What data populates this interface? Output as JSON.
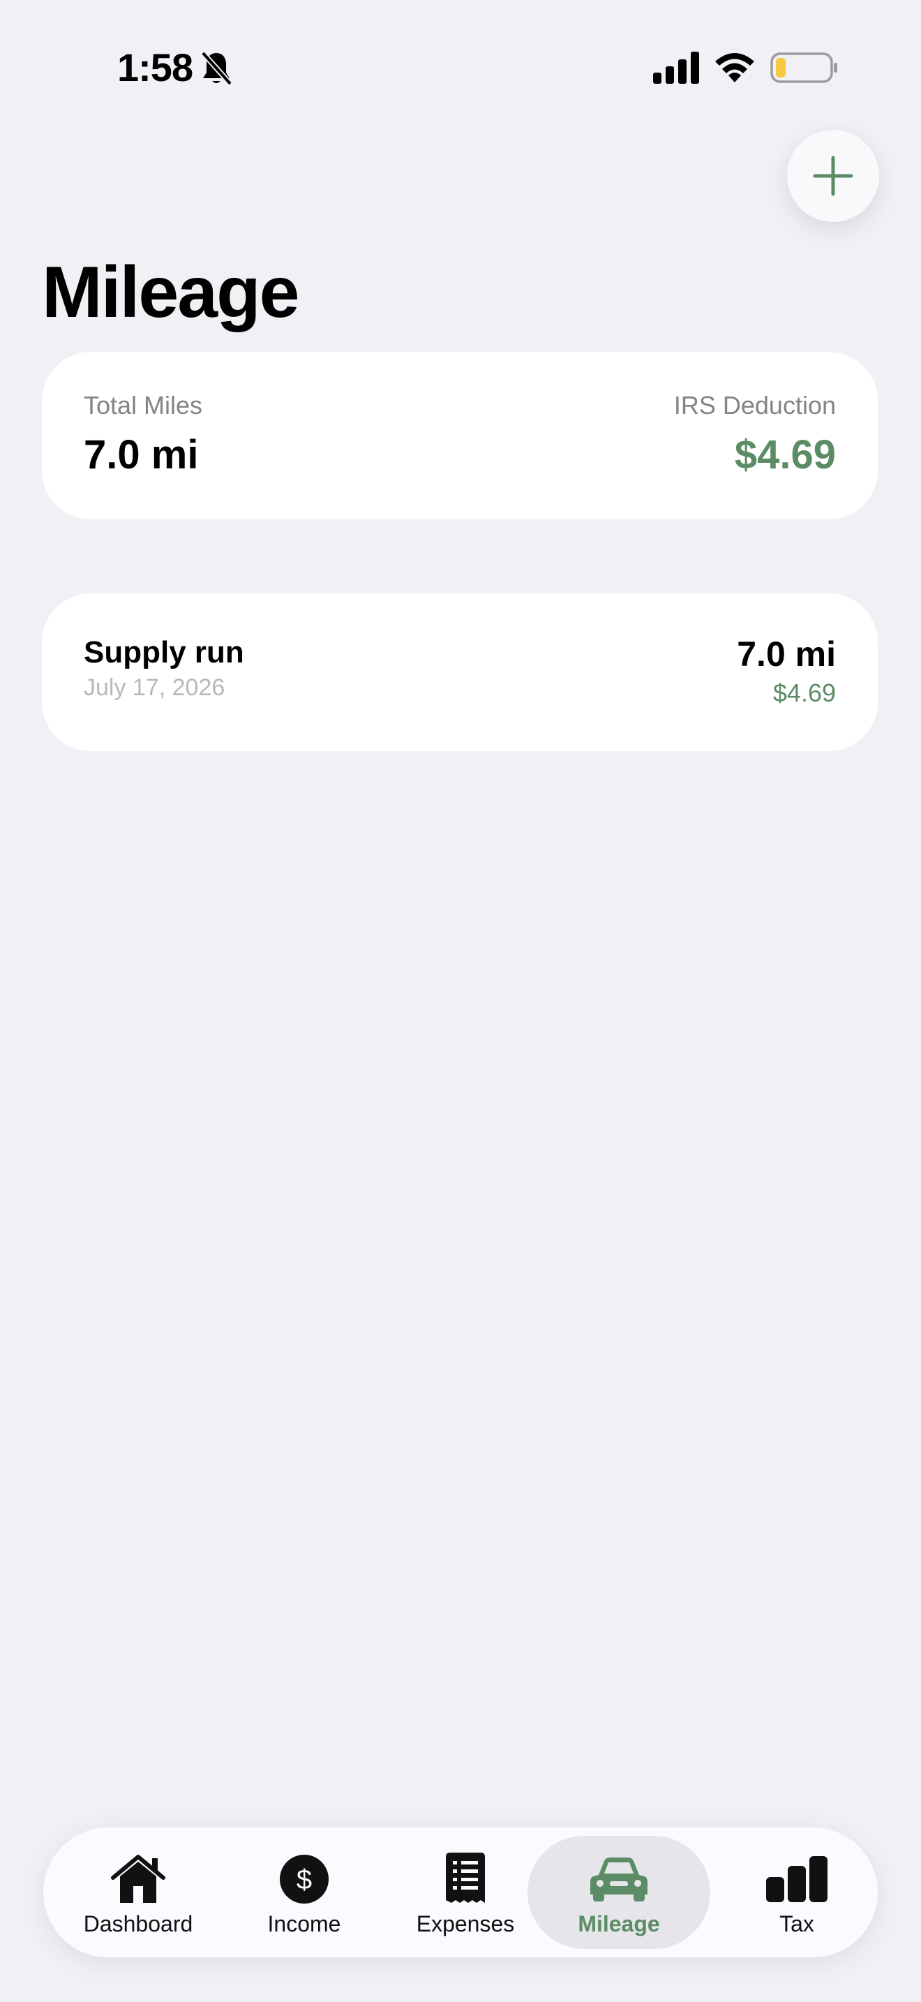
{
  "status_bar": {
    "time": "1:58"
  },
  "header": {
    "title": "Mileage"
  },
  "summary": {
    "total_miles_label": "Total Miles",
    "total_miles_value": "7.0 mi",
    "deduction_label": "IRS Deduction",
    "deduction_value": "$4.69"
  },
  "trips": [
    {
      "name": "Supply run",
      "date": "July 17, 2026",
      "miles": "7.0 mi",
      "amount": "$4.69"
    }
  ],
  "tabs": [
    {
      "label": "Dashboard",
      "icon": "house-icon",
      "active": false
    },
    {
      "label": "Income",
      "icon": "dollar-circle-icon",
      "active": false
    },
    {
      "label": "Expenses",
      "icon": "receipt-icon",
      "active": false
    },
    {
      "label": "Mileage",
      "icon": "car-icon",
      "active": true
    },
    {
      "label": "Tax",
      "icon": "bar-chart-icon",
      "active": false
    }
  ],
  "colors": {
    "accent": "#5b8c66",
    "background": "#f1f0f5",
    "card": "#ffffff",
    "battery_low": "#f5c842"
  }
}
